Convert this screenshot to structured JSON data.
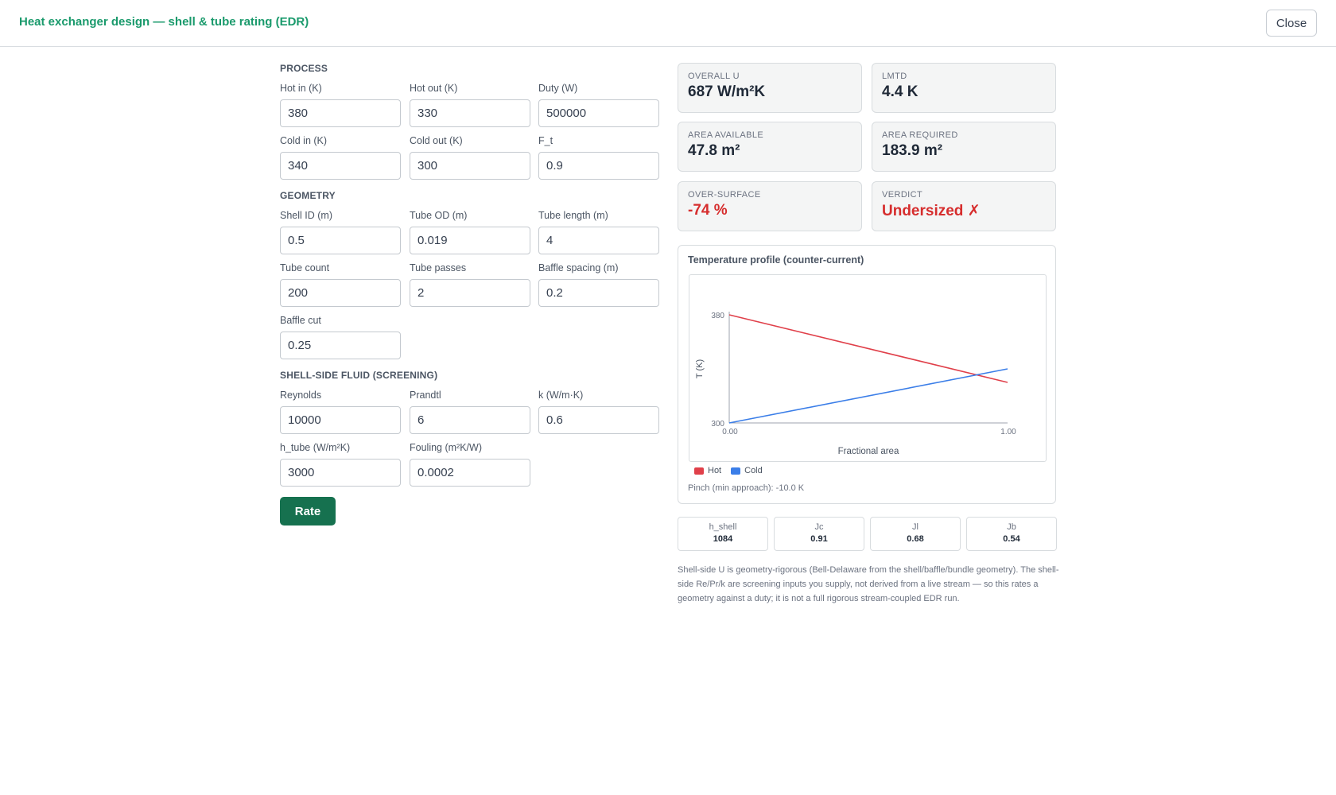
{
  "header": {
    "title": "Heat exchanger design — shell & tube rating (EDR)",
    "close_label": "Close"
  },
  "process": {
    "heading": "PROCESS",
    "fields": [
      {
        "label": "Hot in (K)",
        "value": "380"
      },
      {
        "label": "Hot out (K)",
        "value": "330"
      },
      {
        "label": "Duty (W)",
        "value": "500000"
      },
      {
        "label": "Cold in (K)",
        "value": "340"
      },
      {
        "label": "Cold out (K)",
        "value": "300"
      },
      {
        "label": "F_t",
        "value": "0.9"
      }
    ]
  },
  "geometry": {
    "heading": "GEOMETRY",
    "fields": [
      {
        "label": "Shell ID (m)",
        "value": "0.5"
      },
      {
        "label": "Tube OD (m)",
        "value": "0.019"
      },
      {
        "label": "Tube length (m)",
        "value": "4"
      },
      {
        "label": "Tube count",
        "value": "200"
      },
      {
        "label": "Tube passes",
        "value": "2"
      },
      {
        "label": "Baffle spacing (m)",
        "value": "0.2"
      },
      {
        "label": "Baffle cut",
        "value": "0.25"
      }
    ]
  },
  "shell_fluid": {
    "heading": "SHELL-SIDE FLUID (SCREENING)",
    "fields": [
      {
        "label": "Reynolds",
        "value": "10000"
      },
      {
        "label": "Prandtl",
        "value": "6"
      },
      {
        "label": "k (W/m·K)",
        "value": "0.6"
      },
      {
        "label": "h_tube (W/m²K)",
        "value": "3000"
      },
      {
        "label": "Fouling (m²K/W)",
        "value": "0.0002"
      }
    ]
  },
  "rate_label": "Rate",
  "results": [
    {
      "label": "OVERALL U",
      "value": "687 W/m²K"
    },
    {
      "label": "LMTD",
      "value": "4.4 K"
    },
    {
      "label": "AREA AVAILABLE",
      "value": "47.8 m²"
    },
    {
      "label": "AREA REQUIRED",
      "value": "183.9 m²"
    },
    {
      "label": "OVER-SURFACE",
      "value": "-74 %"
    },
    {
      "label": "VERDICT",
      "value": "Undersized ✗"
    }
  ],
  "colors": {
    "accent": "#16714f",
    "title": "#1a9a6c",
    "bad": "#d62d2d",
    "hot": "#e0404a",
    "cold": "#3b7ee8"
  },
  "chart_data": {
    "type": "line",
    "title": "Temperature profile (counter-current)",
    "xlabel": "Fractional area",
    "ylabel": "T (K)",
    "xlim": [
      0,
      1
    ],
    "ylim": [
      300,
      380
    ],
    "x_ticks": [
      "0.00",
      "1.00"
    ],
    "y_ticks": [
      "300",
      "380"
    ],
    "series": [
      {
        "name": "Hot",
        "color": "#e0404a",
        "x": [
          0,
          1
        ],
        "y": [
          380,
          330
        ]
      },
      {
        "name": "Cold",
        "color": "#3b7ee8",
        "x": [
          0,
          1
        ],
        "y": [
          300,
          340
        ]
      }
    ],
    "legend": "bottom-left",
    "grid": false
  },
  "pinch_text": "Pinch (min approach): -10.0 K",
  "coefficients": [
    {
      "label": "h_shell",
      "value": "1084"
    },
    {
      "label": "Jc",
      "value": "0.91"
    },
    {
      "label": "Jl",
      "value": "0.68"
    },
    {
      "label": "Jb",
      "value": "0.54"
    }
  ],
  "note": "Shell-side U is geometry-rigorous (Bell-Delaware from the shell/baffle/bundle geometry). The shell-side Re/Pr/k are screening inputs you supply, not derived from a live stream — so this rates a geometry against a duty; it is not a full rigorous stream-coupled EDR run."
}
